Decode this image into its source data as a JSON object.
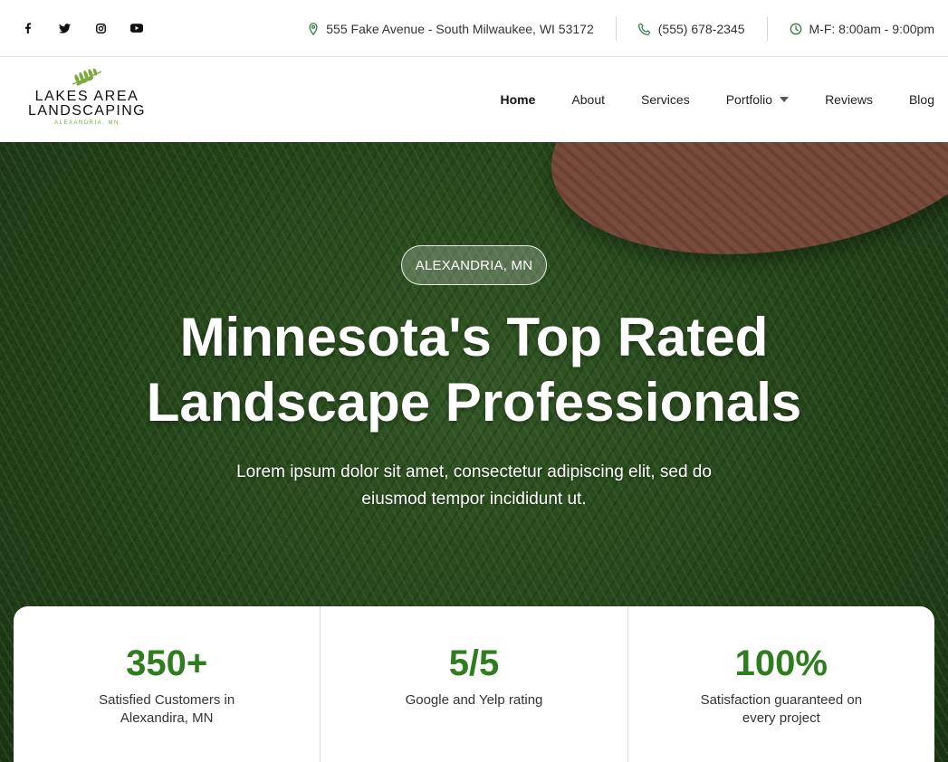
{
  "topbar": {
    "social": [
      {
        "icon": "facebook-icon",
        "glyph": "f"
      },
      {
        "icon": "twitter-icon",
        "glyph": ""
      },
      {
        "icon": "instagram-icon",
        "glyph": ""
      },
      {
        "icon": "youtube-icon",
        "glyph": ""
      }
    ],
    "address": "555 Fake Avenue - South Milwaukee, WI 53172",
    "phone": "(555) 678-2345",
    "hours": "M-F: 8:00am - 9:00pm",
    "icon_color": "#2f7d4a"
  },
  "logo": {
    "line1": "LAKES AREA",
    "line2": "LANDSCAPING",
    "line3": "ALEXANDRIA, MN",
    "accent": "#7aaa3c"
  },
  "nav": {
    "items": [
      {
        "label": "Home",
        "active": true
      },
      {
        "label": "About"
      },
      {
        "label": "Services"
      },
      {
        "label": "Portfolio",
        "dropdown": true
      },
      {
        "label": "Reviews"
      },
      {
        "label": "Blog"
      }
    ]
  },
  "hero": {
    "badge": "ALEXANDRIA, MN",
    "headline_line1": "Minnesota's Top Rated",
    "headline_line2": "Landscape Professionals",
    "sub_line1": "Lorem ipsum dolor sit amet, consectetur adipiscing elit, sed do",
    "sub_line2": "eiusmod tempor incididunt ut."
  },
  "stats": [
    {
      "number": "350+",
      "label": "Satisfied Customers in Alexandira, MN"
    },
    {
      "number": "5/5",
      "label": "Google and Yelp rating"
    },
    {
      "number": "100%",
      "label": "Satisfaction guaranteed on every project"
    }
  ],
  "colors": {
    "accent_green": "#2f7d1f"
  }
}
